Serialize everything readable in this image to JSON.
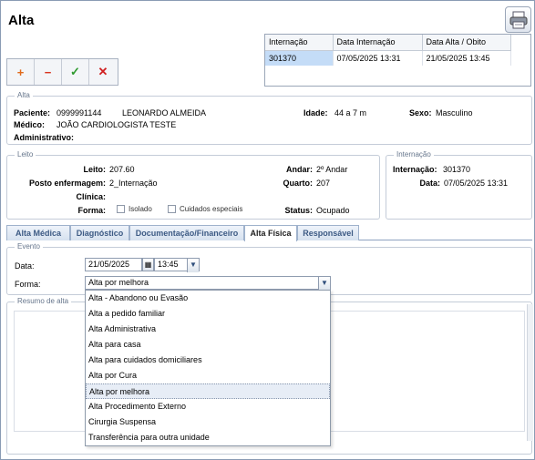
{
  "window": {
    "title": "Alta",
    "print_icon": "printer-icon"
  },
  "toolbar": {
    "add_icon": "+",
    "remove_icon": "−",
    "confirm_icon": "✓",
    "cancel_icon": "✕"
  },
  "grid": {
    "headers": [
      "Internação",
      "Data Internação",
      "Data Alta / Obito"
    ],
    "row": [
      "301370",
      "07/05/2025 13:31",
      "21/05/2025 13:45"
    ]
  },
  "alta": {
    "group_label": "Alta",
    "paciente_label": "Paciente:",
    "paciente_id": "0999991144",
    "paciente_nome": "LEONARDO ALMEIDA",
    "idade_label": "Idade:",
    "idade": "44 a 7 m",
    "sexo_label": "Sexo:",
    "sexo": "Masculino",
    "medico_label": "Médico:",
    "medico": "JOÃO CARDIOLOGISTA TESTE",
    "administrativo_label": "Administrativo:"
  },
  "leito": {
    "group_label": "Leito",
    "leito_label": "Leito:",
    "leito": "207.60",
    "posto_label": "Posto enfermagem:",
    "posto": "2_Internação",
    "clinica_label": "Clínica:",
    "forma_label": "Forma:",
    "isolado": "Isolado",
    "cuidados": "Cuidados especiais",
    "andar_label": "Andar:",
    "andar": "2º Andar",
    "quarto_label": "Quarto:",
    "quarto": "207",
    "status_label": "Status:",
    "status": "Ocupado"
  },
  "internacao": {
    "group_label": "Internação",
    "internacao_label": "Internação:",
    "internacao": "301370",
    "data_label": "Data:",
    "data": "07/05/2025 13:31"
  },
  "tabs": [
    "Alta Médica",
    "Diagnóstico",
    "Documentação/Financeiro",
    "Alta Física",
    "Responsável"
  ],
  "evento": {
    "group_label": "Evento",
    "data_label": "Data:",
    "data_value": "21/05/2025",
    "hora_value": "13:45",
    "forma_label": "Forma:",
    "forma_value": "Alta por melhora"
  },
  "resumo": {
    "group_label": "Resumo de alta"
  },
  "dropdown_options": [
    "Alta - Abandono ou Evasão",
    "Alta a pedido familiar",
    "Alta Administrativa",
    "Alta para casa",
    "Alta para cuidados domiciliares",
    "Alta por Cura",
    "Alta por melhora",
    "Alta Procedimento Externo",
    "Cirurgia Suspensa",
    "Transferência para outra unidade"
  ],
  "colors": {
    "accent_tab": "#3c5a84",
    "selected_row": "#c4dcf7",
    "add": "#e06a1b",
    "remove": "#d8341f",
    "confirm": "#2e9a2e",
    "cancel": "#d02020"
  }
}
